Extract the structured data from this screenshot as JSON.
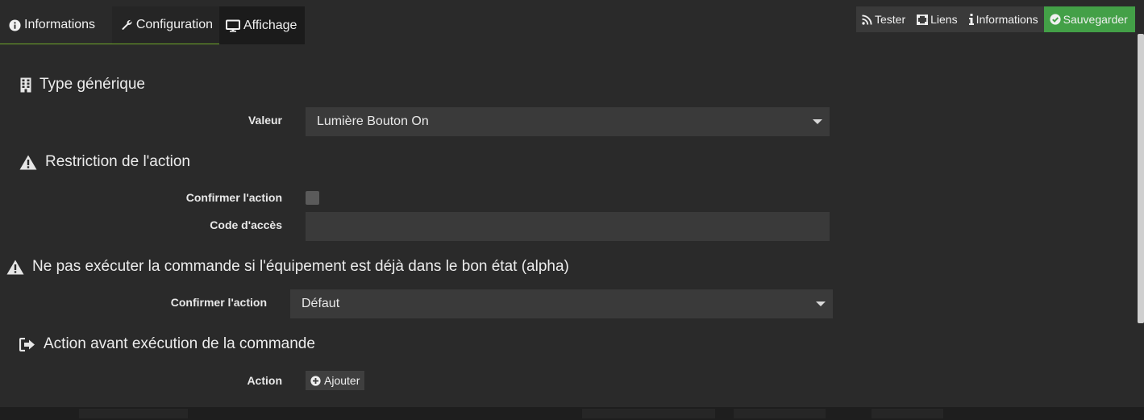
{
  "tabs": [
    {
      "label": "Informations",
      "icon": "info-circle-icon"
    },
    {
      "label": "Configuration",
      "icon": "wrench-icon"
    },
    {
      "label": "Affichage",
      "icon": "monitor-icon"
    }
  ],
  "toolbar": {
    "test_label": "Tester",
    "links_label": "Liens",
    "info_label": "Informations",
    "save_label": "Sauvegarder"
  },
  "generic_type": {
    "title": "Type générique",
    "value_label": "Valeur",
    "value": "Lumière Bouton On"
  },
  "restriction": {
    "title": "Restriction de l'action",
    "confirm_label": "Confirmer l'action",
    "confirm_checked": false,
    "code_label": "Code d'accès",
    "code_value": ""
  },
  "no_execute": {
    "title": "Ne pas exécuter la commande si l'équipement est déjà dans le bon état (alpha)",
    "confirm_label": "Confirmer l'action",
    "confirm_value": "Défaut"
  },
  "pre_action": {
    "title": "Action avant exécution de la commande",
    "action_label": "Action",
    "add_label": "Ajouter"
  },
  "colors": {
    "background": "#2a2a2a",
    "field": "#3a3a3a",
    "save": "#43a047",
    "tab_underline": "#6fa82a"
  }
}
